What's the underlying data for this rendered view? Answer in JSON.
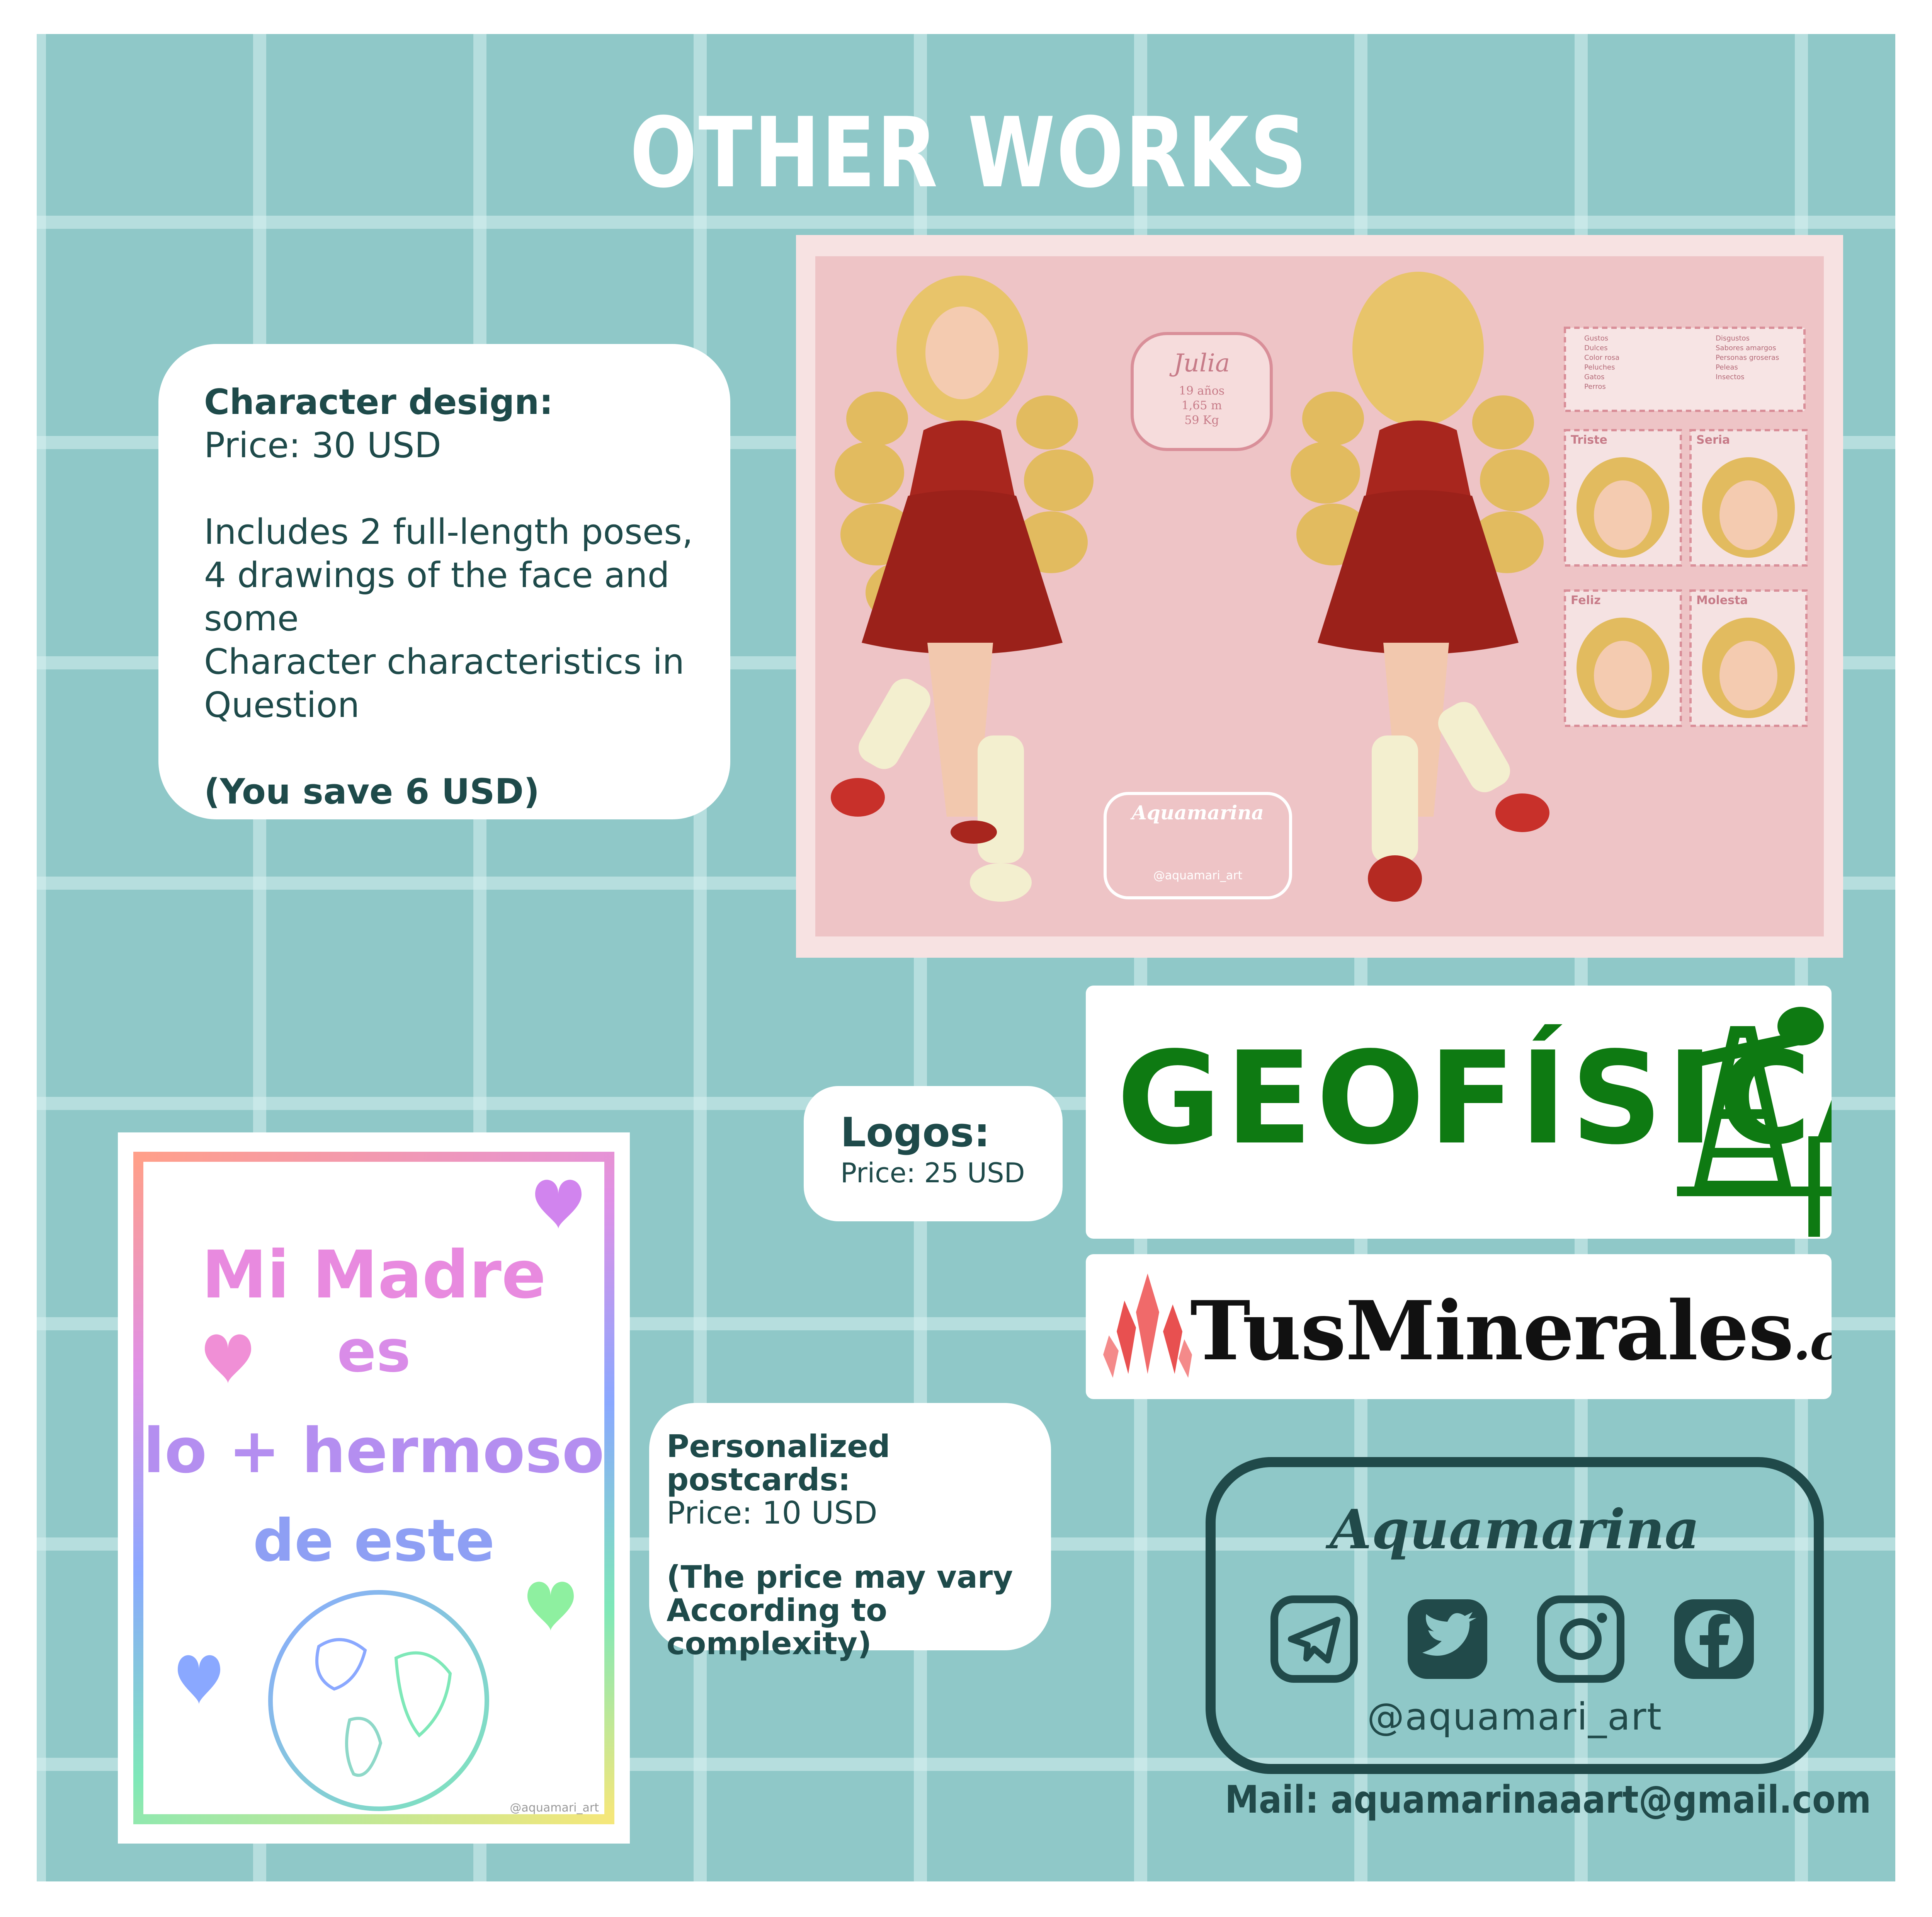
{
  "title": "OTHER WORKS",
  "character_design": {
    "heading": "Character design:",
    "price": "Price: 30 USD",
    "desc_line1": "Includes 2 full-length poses,",
    "desc_line2": "4 drawings of the face and some",
    "desc_line3": "Character characteristics in",
    "desc_line4": "Question",
    "savings": "(You save 6 USD)"
  },
  "character_sheet": {
    "name": "Julia",
    "stats": [
      "19 años",
      "1,65 m",
      "59 Kg"
    ],
    "likes_title": "Gustos",
    "likes": [
      "Dulces",
      "Color rosa",
      "Peluches",
      "Gatos",
      "Perros"
    ],
    "dislikes_title": "Disgustos",
    "dislikes": [
      "Sabores amargos",
      "Personas groseras",
      "Peleas",
      "Insectos"
    ],
    "expressions": [
      "Triste",
      "Seria",
      "Feliz",
      "Molesta"
    ],
    "watermark_brand": "Aquamarina",
    "watermark_handle": "@aquamari_art"
  },
  "logos": {
    "heading": "Logos:",
    "price": "Price: 25 USD",
    "logo1": "GEOFÍSICA",
    "logo2_main": "TusMinerales",
    "logo2_suffix": ".com"
  },
  "postcard": {
    "line1": "Mi Madre",
    "line2": "es",
    "line3": "lo + hermoso",
    "line4": "de este",
    "watermark": "@aquamari_art"
  },
  "postcards_info": {
    "heading": "Personalized postcards:",
    "price": "Price: 10 USD",
    "note_line1": "(The price may vary",
    "note_line2": "According to complexity)"
  },
  "social": {
    "brand": "Aquamarina",
    "handle": "@aquamari_art",
    "icons": [
      "telegram-icon",
      "twitter-icon",
      "instagram-icon",
      "facebook-icon"
    ]
  },
  "mail": "Mail: aquamarinaaart@gmail.com",
  "colors": {
    "background": "#8fc8c8",
    "text_dark": "#1e4a4a",
    "geo_green": "#0e7a12",
    "sheet_pink": "#eec4c6",
    "dress_red": "#a8261e"
  }
}
